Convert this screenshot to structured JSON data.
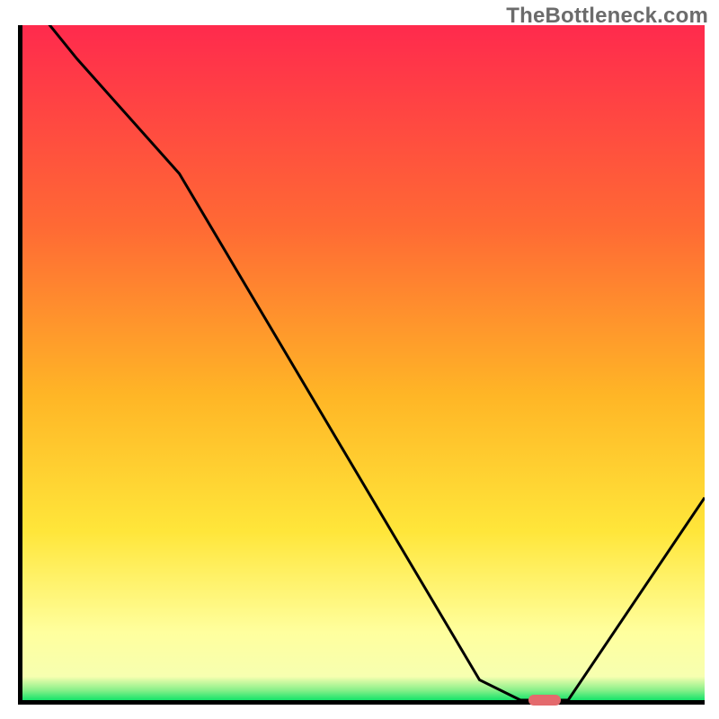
{
  "watermark": "TheBottleneck.com",
  "colors": {
    "gradient_top": "#ff2a4d",
    "gradient_mid1": "#ff6a34",
    "gradient_mid2": "#ffb626",
    "gradient_mid3": "#ffe63a",
    "gradient_yellow_pale": "#ffff9e",
    "gradient_green": "#15e36a",
    "curve": "#000000",
    "marker": "#e46a6d",
    "axis": "#000000"
  },
  "chart_data": {
    "type": "line",
    "title": "",
    "xlabel": "",
    "ylabel": "",
    "xlim": [
      0,
      100
    ],
    "ylim": [
      0,
      100
    ],
    "x": [
      0,
      8,
      23,
      67,
      73,
      80,
      100
    ],
    "values": [
      105,
      95,
      78,
      3,
      0,
      0,
      30
    ],
    "marker": {
      "x_start": 73,
      "x_end": 80,
      "y": 0
    },
    "annotations": [],
    "grid": false,
    "legend": false,
    "gradient_stops": [
      {
        "offset": 0.0,
        "color": "#ff2a4d"
      },
      {
        "offset": 0.3,
        "color": "#ff6a34"
      },
      {
        "offset": 0.55,
        "color": "#ffb626"
      },
      {
        "offset": 0.75,
        "color": "#ffe63a"
      },
      {
        "offset": 0.9,
        "color": "#ffff9e"
      },
      {
        "offset": 0.965,
        "color": "#f7ffb0"
      },
      {
        "offset": 0.985,
        "color": "#8af08a"
      },
      {
        "offset": 1.0,
        "color": "#15e36a"
      }
    ]
  }
}
